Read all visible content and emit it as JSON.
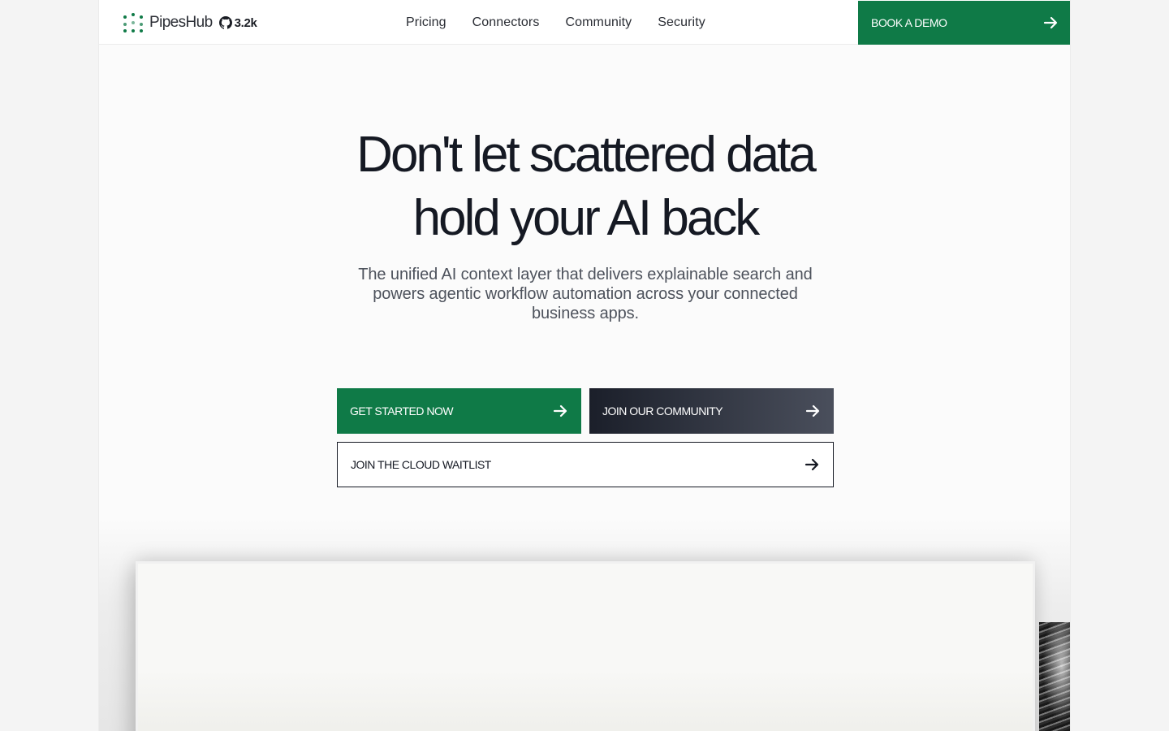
{
  "nav": {
    "brand": "PipesHub",
    "github_stars": "3.2k",
    "links": [
      "Pricing",
      "Connectors",
      "Community",
      "Security"
    ],
    "cta_label": "BOOK A DEMO"
  },
  "hero": {
    "title_line1": "Don't let scattered data",
    "title_line2": "hold your AI back",
    "subtitle": "The unified AI context layer that delivers explainable search and powers agentic workflow automation across your connected business apps.",
    "primary_button": "GET STARTED NOW",
    "secondary_button": "JOIN OUR COMMUNITY",
    "tertiary_button": "JOIN THE CLOUD WAITLIST"
  },
  "colors": {
    "brand_green": "#0f7a47",
    "dark": "#1b1f2a"
  },
  "icons": [
    "pipeshub-logo-icon",
    "github-icon",
    "arrow-right-icon"
  ]
}
